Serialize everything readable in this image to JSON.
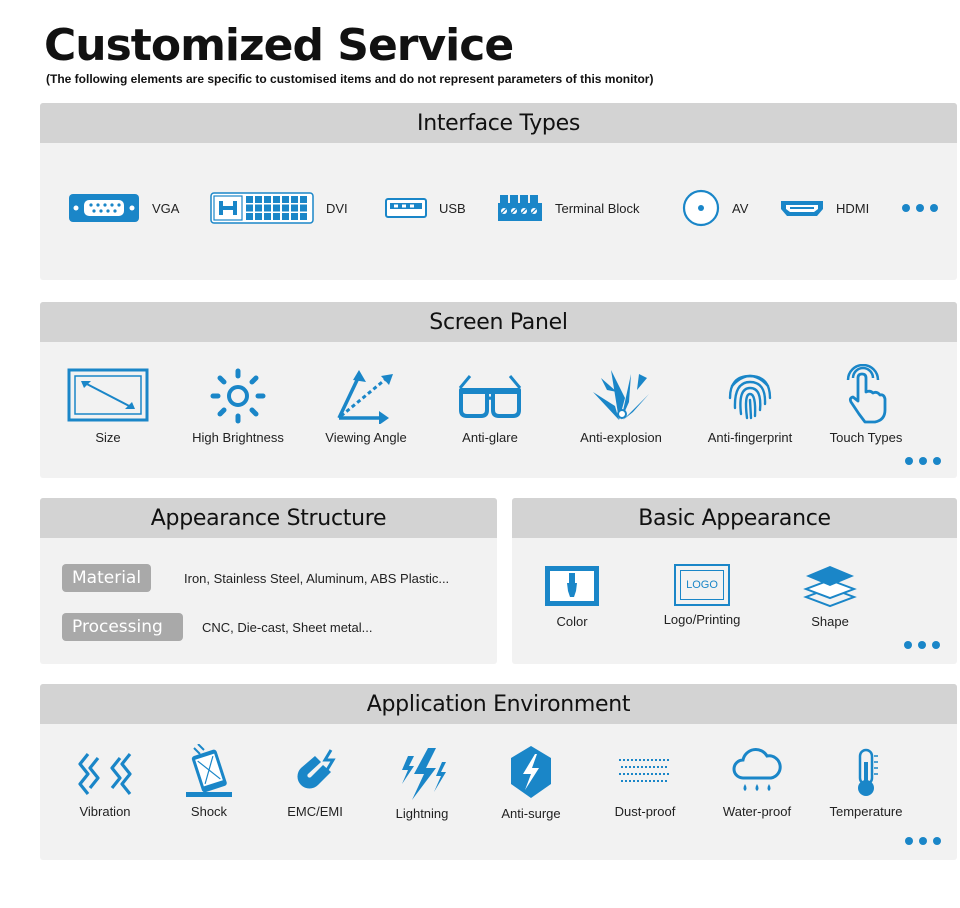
{
  "header": {
    "title": "Customized Service",
    "subtitle": "(The following elements are specific to customised items and do not represent parameters of this monitor)"
  },
  "colors": {
    "accent": "#1a86c8",
    "panel_bg": "#f2f2f2",
    "panel_head": "#d3d3d3",
    "pill": "#a9a9a9"
  },
  "interface_types": {
    "heading": "Interface Types",
    "items": [
      {
        "icon": "vga-port-icon",
        "label": "VGA"
      },
      {
        "icon": "dvi-port-icon",
        "label": "DVI"
      },
      {
        "icon": "usb-port-icon",
        "label": "USB"
      },
      {
        "icon": "terminal-block-icon",
        "label": "Terminal Block"
      },
      {
        "icon": "av-port-icon",
        "label": "AV"
      },
      {
        "icon": "hdmi-port-icon",
        "label": "HDMI"
      }
    ]
  },
  "screen_panel": {
    "heading": "Screen Panel",
    "items": [
      {
        "icon": "size-icon",
        "label": "Size"
      },
      {
        "icon": "brightness-icon",
        "label": "High Brightness"
      },
      {
        "icon": "viewing-angle-icon",
        "label": "Viewing Angle"
      },
      {
        "icon": "glasses-icon",
        "label": "Anti-glare"
      },
      {
        "icon": "explosion-icon",
        "label": "Anti-explosion"
      },
      {
        "icon": "fingerprint-icon",
        "label": "Anti-fingerprint"
      },
      {
        "icon": "touch-icon",
        "label": "Touch Types"
      }
    ]
  },
  "appearance_structure": {
    "heading": "Appearance Structure",
    "rows": [
      {
        "label": "Material",
        "value": "Iron, Stainless Steel, Aluminum, ABS Plastic..."
      },
      {
        "label": "Processing",
        "value": "CNC, Die-cast, Sheet metal..."
      }
    ]
  },
  "basic_appearance": {
    "heading": "Basic Appearance",
    "logo_text": "LOGO",
    "items": [
      {
        "icon": "color-brush-icon",
        "label": "Color"
      },
      {
        "icon": "logo-icon",
        "label": "Logo/Printing"
      },
      {
        "icon": "layers-icon",
        "label": "Shape"
      }
    ]
  },
  "application_environment": {
    "heading": "Application Environment",
    "items": [
      {
        "icon": "vibration-icon",
        "label": "Vibration"
      },
      {
        "icon": "shock-icon",
        "label": "Shock"
      },
      {
        "icon": "magnet-icon",
        "label": "EMC/EMI"
      },
      {
        "icon": "lightning-icon",
        "label": "Lightning"
      },
      {
        "icon": "surge-shield-icon",
        "label": "Anti-surge"
      },
      {
        "icon": "dust-icon",
        "label": "Dust-proof"
      },
      {
        "icon": "rain-cloud-icon",
        "label": "Water-proof"
      },
      {
        "icon": "thermometer-icon",
        "label": "Temperature"
      }
    ]
  }
}
